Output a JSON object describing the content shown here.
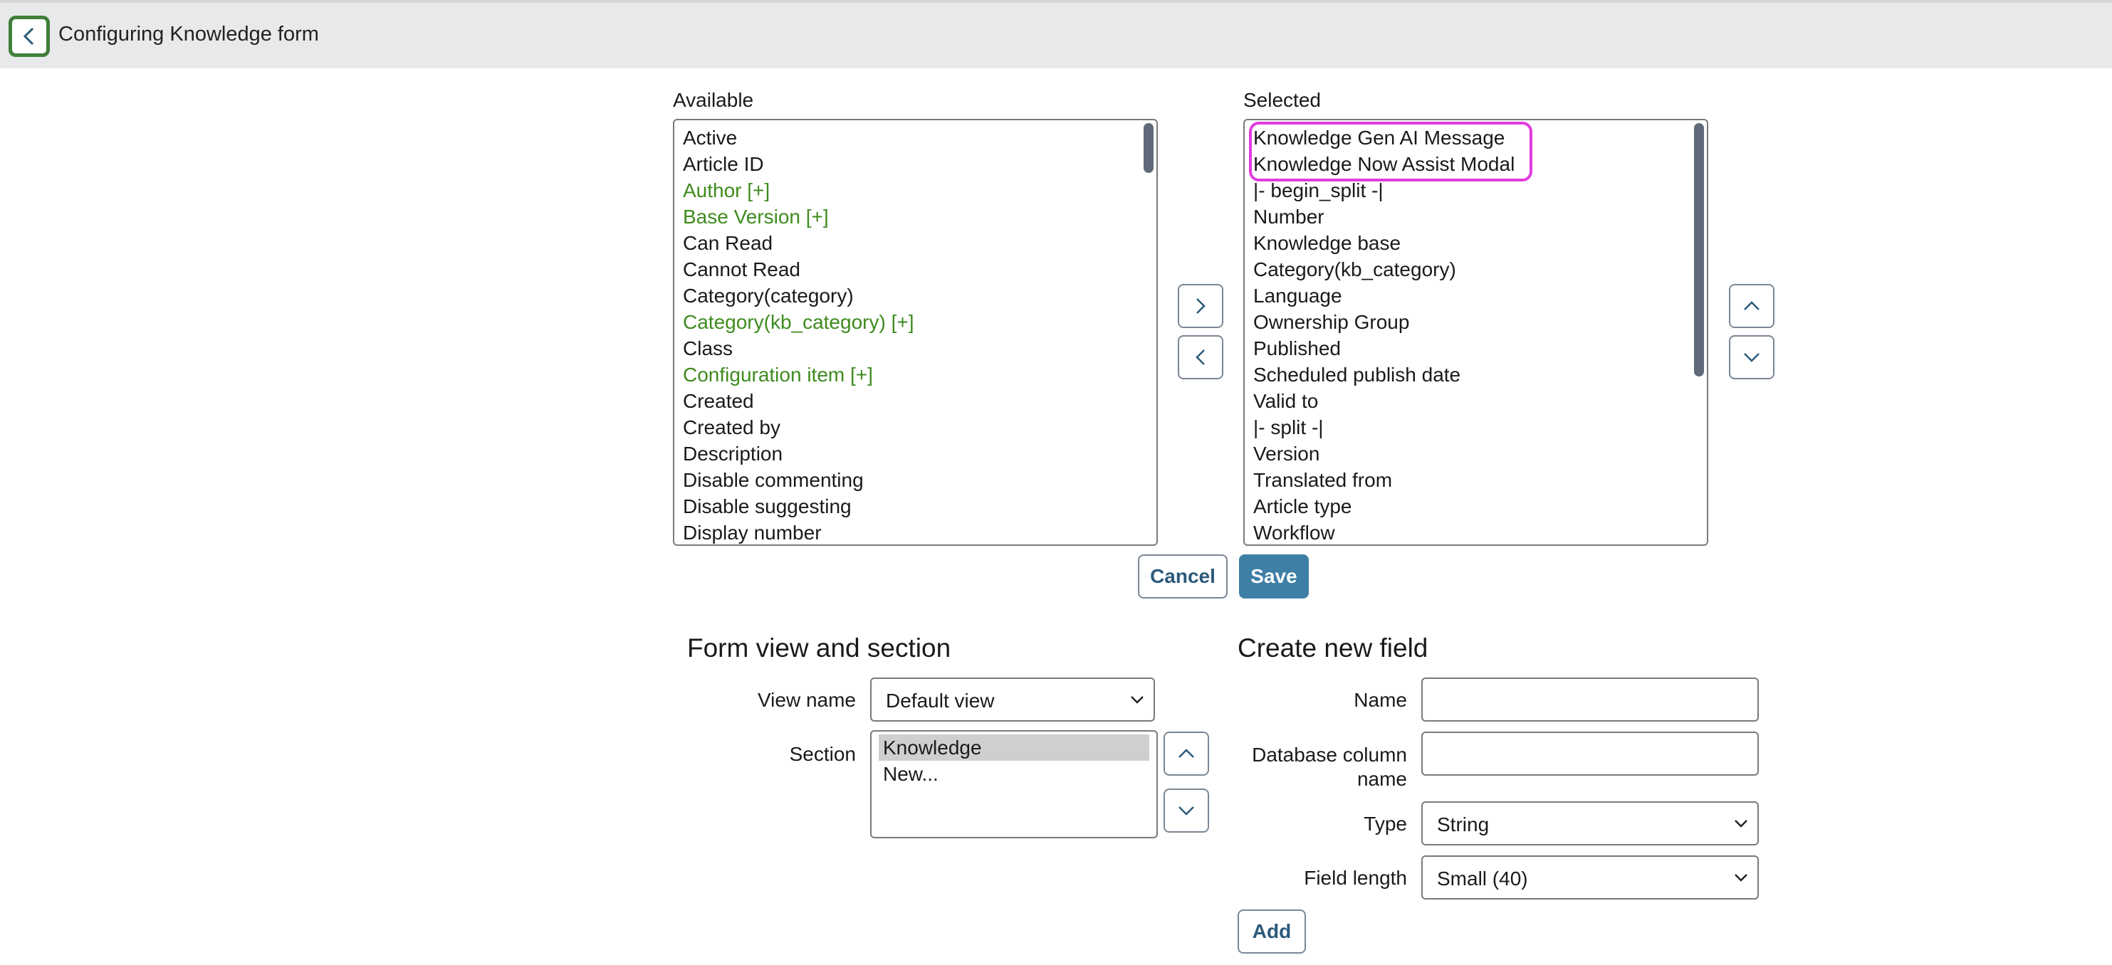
{
  "header": {
    "title": "Configuring Knowledge form",
    "back_icon": "chevron-left-icon"
  },
  "slushbucket": {
    "available_label": "Available",
    "selected_label": "Selected",
    "available_items": [
      {
        "label": "Active",
        "reference": false
      },
      {
        "label": "Article ID",
        "reference": false
      },
      {
        "label": "Author [+]",
        "reference": true
      },
      {
        "label": "Base Version [+]",
        "reference": true
      },
      {
        "label": "Can Read",
        "reference": false
      },
      {
        "label": "Cannot Read",
        "reference": false
      },
      {
        "label": "Category(category)",
        "reference": false
      },
      {
        "label": "Category(kb_category) [+]",
        "reference": true
      },
      {
        "label": "Class",
        "reference": false
      },
      {
        "label": "Configuration item [+]",
        "reference": true
      },
      {
        "label": "Created",
        "reference": false
      },
      {
        "label": "Created by",
        "reference": false
      },
      {
        "label": "Description",
        "reference": false
      },
      {
        "label": "Disable commenting",
        "reference": false
      },
      {
        "label": "Disable suggesting",
        "reference": false
      },
      {
        "label": "Display number",
        "reference": false
      }
    ],
    "selected_items": [
      "Knowledge Gen AI Message",
      "Knowledge Now Assist Modal",
      "|- begin_split -|",
      "Number",
      "Knowledge base",
      "Category(kb_category)",
      "Language",
      "Ownership Group",
      "Published",
      "Scheduled publish date",
      "Valid to",
      "|- split -|",
      "Version",
      "Translated from",
      "Article type",
      "Workflow"
    ],
    "highlighted_items": [
      "Knowledge Gen AI Message",
      "Knowledge Now Assist Modal"
    ],
    "add_icon": "chevron-right-icon",
    "remove_icon": "chevron-left-icon",
    "move_up_icon": "chevron-up-icon",
    "move_down_icon": "chevron-down-icon",
    "cancel_label": "Cancel",
    "save_label": "Save"
  },
  "form_view": {
    "heading": "Form view and section",
    "view_name_label": "View name",
    "view_name_value": "Default view",
    "section_label": "Section",
    "sections": [
      "Knowledge",
      "New..."
    ],
    "selected_section": "Knowledge"
  },
  "new_field": {
    "heading": "Create new field",
    "name_label": "Name",
    "name_value": "",
    "db_column_label_line1": "Database column",
    "db_column_label_line2": "name",
    "db_column_value": "",
    "type_label": "Type",
    "type_value": "String",
    "field_length_label": "Field length",
    "field_length_value": "Small (40)",
    "add_label": "Add"
  },
  "colors": {
    "reference_field": "#3e8b1e",
    "highlight": "#e23be0",
    "primary_button": "#3d7fa5",
    "back_button_border": "#3f7f3a",
    "top_bar": "#e8e9ea"
  }
}
